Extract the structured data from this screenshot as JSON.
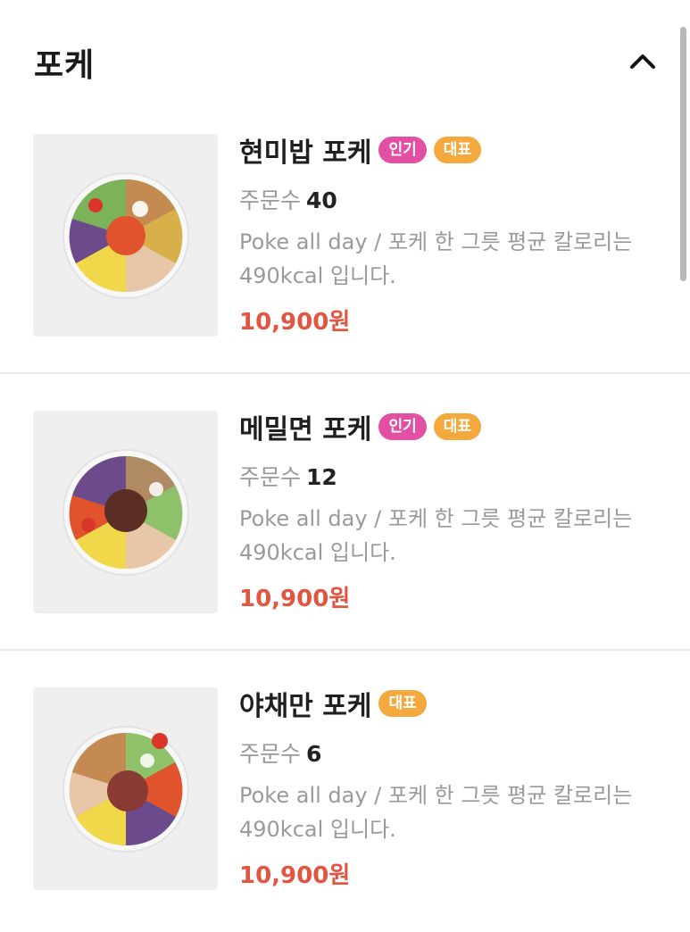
{
  "section": {
    "title": "포케",
    "collapse_icon": "chevron-up-icon"
  },
  "menu_items": [
    {
      "name": "현미밥 포케",
      "badges": [
        "인기",
        "대표"
      ],
      "order_label": "주문수",
      "order_count": "40",
      "description": "Poke all day / 포케 한 그릇 평균 칼로리는 490kcal 입니다.",
      "price": "10,900원"
    },
    {
      "name": "메밀면 포케",
      "badges": [
        "인기",
        "대표"
      ],
      "order_label": "주문수",
      "order_count": "12",
      "description": "Poke all day / 포케 한 그릇 평균 칼로리는 490kcal 입니다.",
      "price": "10,900원"
    },
    {
      "name": "야채만 포케",
      "badges": [
        "대표"
      ],
      "order_label": "주문수",
      "order_count": "6",
      "description": "Poke all day / 포케 한 그릇 평균 칼로리는 490kcal 입니다.",
      "price": "10,900원"
    }
  ],
  "colors": {
    "popular_badge": "#e34fa3",
    "signature_badge": "#f3a93d",
    "price": "#e25540",
    "muted_text": "#999999"
  }
}
